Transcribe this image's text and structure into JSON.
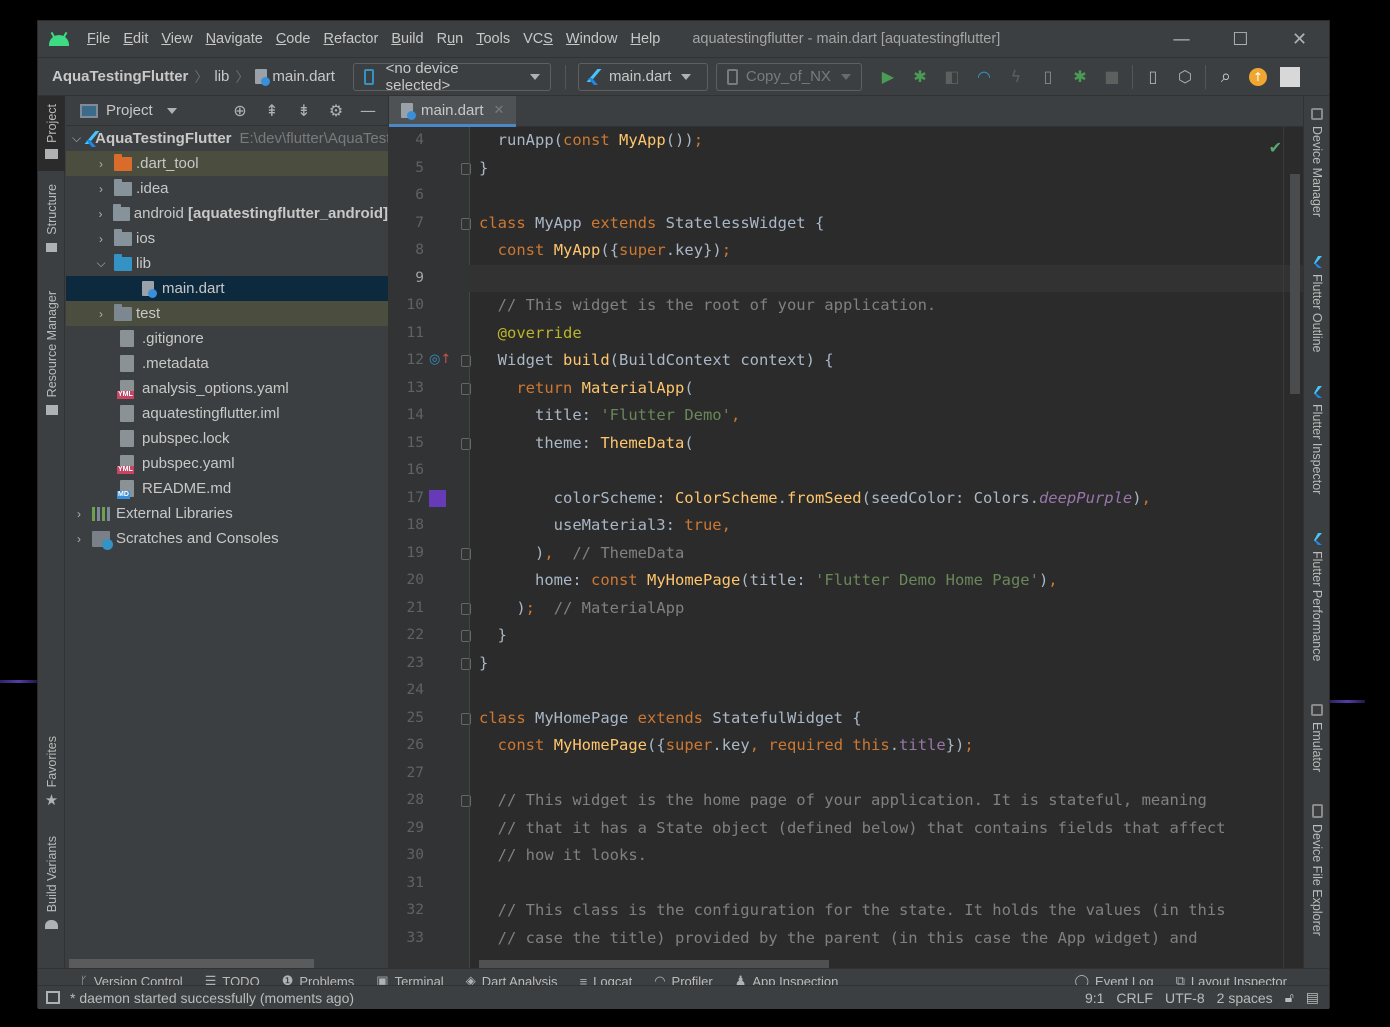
{
  "window": {
    "title": "aquatestingflutter - main.dart [aquatestingflutter]",
    "controls": {
      "minimize": "—",
      "maximize": "☐",
      "close": "✕"
    }
  },
  "menu": [
    {
      "label": "File",
      "mnemonic": "F",
      "rest": "ile"
    },
    {
      "label": "Edit",
      "mnemonic": "E",
      "rest": "dit"
    },
    {
      "label": "View",
      "mnemonic": "V",
      "rest": "iew"
    },
    {
      "label": "Navigate",
      "mnemonic": "N",
      "rest": "avigate"
    },
    {
      "label": "Code",
      "mnemonic": "C",
      "rest": "ode"
    },
    {
      "label": "Refactor",
      "mnemonic": "R",
      "rest": "efactor"
    },
    {
      "label": "Build",
      "mnemonic": "B",
      "rest": "uild"
    },
    {
      "label": "Run",
      "pre": "R",
      "mnemonic": "u",
      "rest": "n"
    },
    {
      "label": "Tools",
      "mnemonic": "T",
      "rest": "ools"
    },
    {
      "label": "VCS",
      "pre": "VC",
      "mnemonic": "S",
      "rest": ""
    },
    {
      "label": "Window",
      "mnemonic": "W",
      "rest": "indow"
    },
    {
      "label": "Help",
      "mnemonic": "H",
      "rest": "elp"
    }
  ],
  "breadcrumb": {
    "project": "AquaTestingFlutter",
    "folder": "lib",
    "file": "main.dart"
  },
  "toolbar": {
    "device": "<no device selected>",
    "run_config": "main.dart",
    "avd": "Copy_of_NX",
    "icons": [
      "run-icon",
      "debug-icon",
      "attach-icon",
      "profile-icon",
      "hot-reload-icon",
      "apply-changes-icon",
      "attach-debugger-icon",
      "stop-icon",
      "device-manager-icon",
      "sdk-manager-icon",
      "search-icon",
      "update-icon",
      "account-icon"
    ]
  },
  "left_stripe": {
    "project": "Project",
    "structure": "Structure",
    "resource_manager": "Resource Manager",
    "favorites": "Favorites",
    "build_variants": "Build Variants"
  },
  "project_panel": {
    "title": "Project",
    "tree": [
      {
        "label": "AquaTestingFlutter",
        "path": "E:\\dev\\flutter\\AquaTestingFlutter",
        "type": "root"
      },
      {
        "label": ".dart_tool",
        "type": "folder"
      },
      {
        "label": ".idea",
        "type": "folder"
      },
      {
        "label": "android",
        "module": "[aquatestingflutter_android]",
        "type": "folder"
      },
      {
        "label": "ios",
        "type": "folder"
      },
      {
        "label": "lib",
        "type": "folder"
      },
      {
        "label": "main.dart",
        "type": "file"
      },
      {
        "label": "test",
        "type": "folder"
      },
      {
        "label": ".gitignore",
        "type": "file"
      },
      {
        "label": ".metadata",
        "type": "file"
      },
      {
        "label": "analysis_options.yaml",
        "type": "file",
        "badge": "YML"
      },
      {
        "label": "aquatestingflutter.iml",
        "type": "file"
      },
      {
        "label": "pubspec.lock",
        "type": "file"
      },
      {
        "label": "pubspec.yaml",
        "type": "file",
        "badge": "YML"
      },
      {
        "label": "README.md",
        "type": "file",
        "badge": "MD"
      },
      {
        "label": "External Libraries",
        "type": "libraries"
      },
      {
        "label": "Scratches and Consoles",
        "type": "scratches"
      }
    ]
  },
  "editor": {
    "tab": "main.dart",
    "current_line": 9,
    "line_numbers": [
      "4",
      "5",
      "6",
      "7",
      "8",
      "9",
      "10",
      "11",
      "12",
      "13",
      "14",
      "15",
      "16",
      "17",
      "18",
      "19",
      "20",
      "21",
      "22",
      "23",
      "24",
      "25",
      "26",
      "27",
      "28",
      "29",
      "30",
      "31",
      "32",
      "33"
    ],
    "lines": [
      "  runApp(const MyApp());",
      "}",
      "",
      "class MyApp extends StatelessWidget {",
      "  const MyApp({super.key});",
      "",
      "  // This widget is the root of your application.",
      "  @override",
      "  Widget build(BuildContext context) {",
      "    return MaterialApp(",
      "      title: 'Flutter Demo',",
      "      theme: ThemeData(",
      "",
      "        colorScheme: ColorScheme.fromSeed(seedColor: Colors.deepPurple),",
      "        useMaterial3: true,",
      "      ),  // ThemeData",
      "      home: const MyHomePage(title: 'Flutter Demo Home Page'),",
      "    );  // MaterialApp",
      "  }",
      "}",
      "",
      "class MyHomePage extends StatefulWidget {",
      "  const MyHomePage({super.key, required this.title});",
      "",
      "  // This widget is the home page of your application. It is stateful, meaning",
      "  // that it has a State object (defined below) that contains fields that affect",
      "  // how it looks.",
      "",
      "  // This class is the configuration for the state. It holds the values (in this",
      "  // case the title) provided by the parent (in this case the App widget) and"
    ],
    "seed_color": "#673ab7"
  },
  "right_stripe": [
    "Device Manager",
    "Flutter Outline",
    "Flutter Inspector",
    "Flutter Performance",
    "Emulator",
    "Device File Explorer"
  ],
  "bottom_tools": {
    "left": [
      "Version Control",
      "TODO",
      "Problems",
      "Terminal",
      "Dart Analysis",
      "Logcat",
      "Profiler",
      "App Inspection"
    ],
    "right": [
      "Event Log",
      "Layout Inspector"
    ]
  },
  "status": {
    "message": "* daemon started successfully (moments ago)",
    "position": "9:1",
    "line_sep": "CRLF",
    "encoding": "UTF-8",
    "indent": "2 spaces"
  }
}
